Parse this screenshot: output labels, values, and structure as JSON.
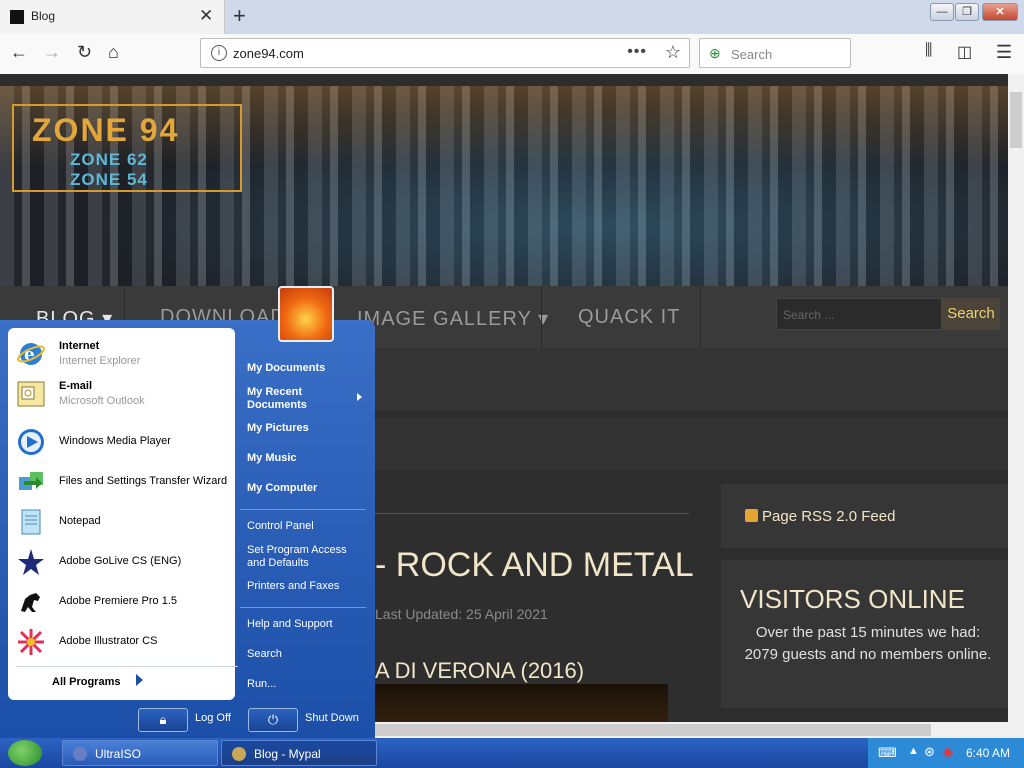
{
  "browser": {
    "tab_title": "Blog",
    "tab_close": "✕",
    "new_tab": "+",
    "url": "zone94.com",
    "url_dots": "•••",
    "search_placeholder": "Search",
    "window_controls": [
      "—",
      "❐",
      "✕"
    ]
  },
  "site": {
    "logo_lines": [
      "ZONE 94",
      "ZONE 62",
      "ZONE 54"
    ],
    "menu": [
      "BLOG ▾",
      "DOWNLOADS",
      "IMAGE GALLERY ▾",
      "QUACK IT"
    ],
    "search_placeholder": "Search ...",
    "search_button": "Search",
    "article_title": "- ROCK AND METAL",
    "article_updated": "Last Updated: 25 April 2021",
    "article_subtitle": "A DI VERONA (2016)",
    "rss_label": "Page RSS 2.0 Feed",
    "visitors_title": "VISITORS ONLINE",
    "visitors_text": "Over the past 15 minutes we had: 2079 guests and no members online."
  },
  "start_menu": {
    "pinned": [
      {
        "name": "Internet",
        "sub": "Internet Explorer"
      },
      {
        "name": "E-mail",
        "sub": "Microsoft Outlook"
      }
    ],
    "programs": [
      "Windows Media Player",
      "Files and Settings Transfer Wizard",
      "Notepad",
      "Adobe GoLive CS (ENG)",
      "Adobe Premiere Pro 1.5",
      "Adobe Illustrator CS"
    ],
    "all_programs": "All Programs",
    "right_items": [
      "My Documents",
      "My Recent Documents",
      "My Pictures",
      "My Music",
      "My Computer",
      "Control Panel",
      "Set Program Access and Defaults",
      "Printers and Faxes",
      "Help and Support",
      "Search",
      "Run..."
    ],
    "log_off": "Log Off",
    "shut_down": "Shut Down"
  },
  "taskbar": {
    "tasks": [
      "UltraISO",
      "Blog - Mypal"
    ],
    "clock": "6:40 AM"
  }
}
